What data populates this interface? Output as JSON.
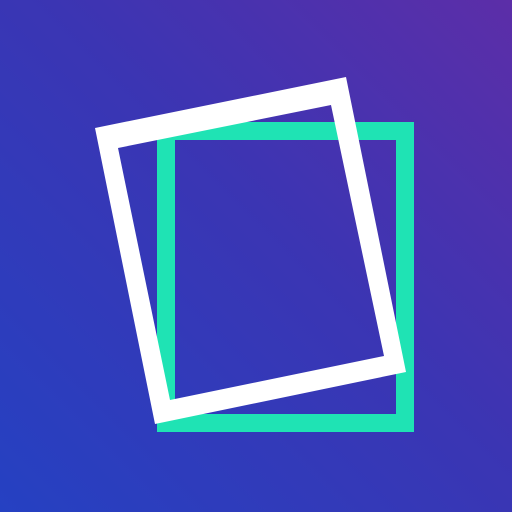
{
  "app_icon": {
    "name": "tilted-frames-icon",
    "colors": {
      "background_gradient_start": "#2541c2",
      "background_gradient_mid": "#3b35b3",
      "background_gradient_end": "#5c2ea8",
      "front_frame": "#ffffff",
      "back_frame": "#1fe3b4"
    }
  }
}
